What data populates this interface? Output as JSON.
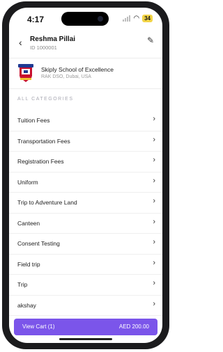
{
  "status_bar": {
    "time": "4:17",
    "battery": "34"
  },
  "header": {
    "name": "Reshma Pillai",
    "id": "ID 1000001"
  },
  "school": {
    "name": "Skiply School of Excellence",
    "location": "RAK DSO, Dubai, USA"
  },
  "section_title": "ALL CATEGORIES",
  "categories": [
    {
      "label": "Tuition Fees"
    },
    {
      "label": "Transportation Fees"
    },
    {
      "label": "Registration Fees"
    },
    {
      "label": "Uniform"
    },
    {
      "label": "Trip to Adventure Land"
    },
    {
      "label": "Canteen"
    },
    {
      "label": "Consent Testing"
    },
    {
      "label": "Field trip"
    },
    {
      "label": "Trip"
    },
    {
      "label": "akshay"
    }
  ],
  "cart": {
    "label": "View Cart (1)",
    "total": "AED 200.00"
  },
  "colors": {
    "accent": "#7b55ea",
    "battery": "#f2d447",
    "frame": "#1b1b1d"
  }
}
